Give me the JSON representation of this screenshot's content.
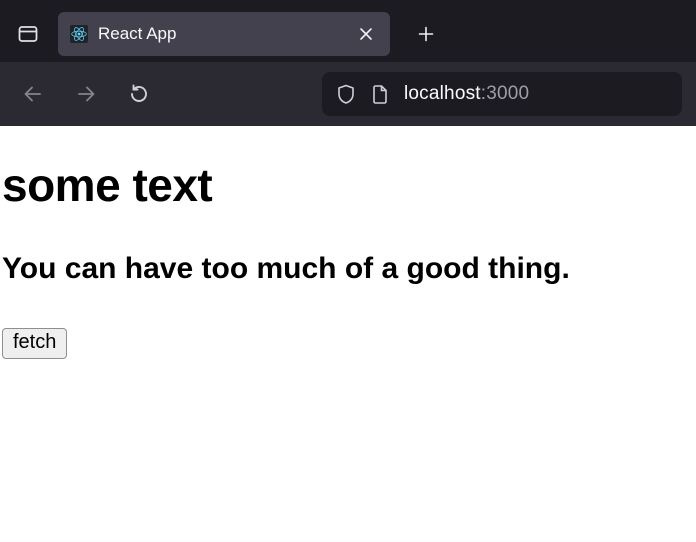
{
  "browser": {
    "tab": {
      "title": "React App"
    },
    "address": {
      "host": "localhost",
      "port": ":3000"
    }
  },
  "page": {
    "heading": "some text",
    "subheading": "You can have too much of a good thing.",
    "button_label": "fetch"
  }
}
